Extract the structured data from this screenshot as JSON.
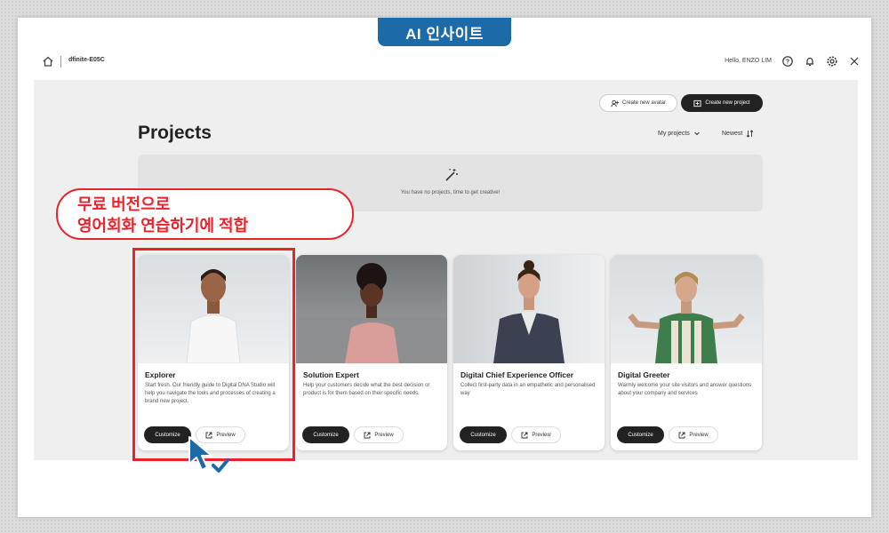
{
  "badge": {
    "label": "AI 인사이트"
  },
  "topbar": {
    "org_name": "dfinite-E05C",
    "greeting": "Hello, ENZO LIM",
    "icons": [
      "home-icon",
      "help-icon",
      "bell-icon",
      "gear-icon",
      "expand-icon"
    ]
  },
  "actions": {
    "create_avatar": "Create new avatar",
    "create_project": "Create new project"
  },
  "page": {
    "title": "Projects",
    "filter_owner": "My projects",
    "sort": "Newest",
    "empty_message": "You have no projects, time to get creative!"
  },
  "callout": {
    "line1": "무료 버전으로",
    "line2": "영어회화 연습하기에 적합"
  },
  "cards": [
    {
      "title": "Explorer",
      "description": "Start fresh. Our friendly guide to Digital DNA Studio will help you navigate the tools and processes of creating a brand new project.",
      "customize": "Customize",
      "preview": "Preview"
    },
    {
      "title": "Solution Expert",
      "description": "Help your customers decide what the best decision or product is for them based on their specific needs.",
      "customize": "Customize",
      "preview": "Preview"
    },
    {
      "title": "Digital Chief Experience Officer",
      "description": "Collect first-party data in an empathetic and personalised way",
      "customize": "Customize",
      "preview": "Preview"
    },
    {
      "title": "Digital Greeter",
      "description": "Warmly welcome your site visitors and answer questions about your company and services",
      "customize": "Customize",
      "preview": "Preview"
    }
  ],
  "colors": {
    "badge": "#1c6aa8",
    "highlight": "#e8232a",
    "dark_button": "#222222"
  }
}
